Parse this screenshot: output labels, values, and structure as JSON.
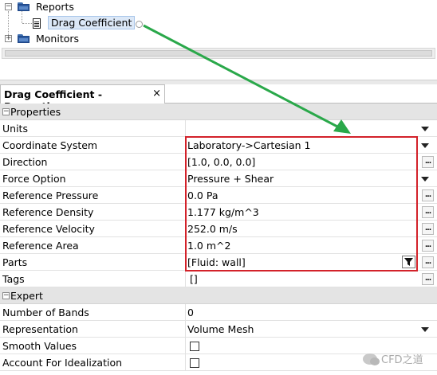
{
  "tree": {
    "reports_label": "Reports",
    "drag_label": "Drag Coefficient",
    "monitors_label": "Monitors"
  },
  "panel": {
    "title": "Drag Coefficient - Properties",
    "close_glyph": "×"
  },
  "sections": {
    "properties": "Properties",
    "expert": "Expert"
  },
  "properties": [
    {
      "name": "Units",
      "value": "",
      "control": "dropdown"
    },
    {
      "name": "Coordinate System",
      "value": "Laboratory->Cartesian 1",
      "control": "dropdown"
    },
    {
      "name": "Direction",
      "value": "[1.0, 0.0, 0.0]",
      "control": "ellipsis"
    },
    {
      "name": "Force Option",
      "value": "Pressure + Shear",
      "control": "dropdown"
    },
    {
      "name": "Reference Pressure",
      "value": "0.0 Pa",
      "control": "ellipsis"
    },
    {
      "name": "Reference Density",
      "value": "1.177 kg/m^3",
      "control": "ellipsis"
    },
    {
      "name": "Reference Velocity",
      "value": "252.0 m/s",
      "control": "ellipsis"
    },
    {
      "name": "Reference Area",
      "value": "1.0 m^2",
      "control": "ellipsis"
    },
    {
      "name": "Parts",
      "value": "[Fluid: wall]",
      "control": "filter+ellipsis"
    },
    {
      "name": "Tags",
      "value": "[]",
      "control": "ellipsis"
    }
  ],
  "expert": [
    {
      "name": "Number of Bands",
      "value": "0",
      "control": "none"
    },
    {
      "name": "Representation",
      "value": "Volume Mesh",
      "control": "dropdown"
    },
    {
      "name": "Smooth Values",
      "value": "",
      "control": "checkbox",
      "checked": false
    },
    {
      "name": "Account For Idealization",
      "value": "",
      "control": "checkbox",
      "checked": false
    }
  ],
  "buttons": {
    "ellipsis": "..."
  },
  "watermark": "CFD之道",
  "colors": {
    "highlight_box": "#d3222a",
    "arrow": "#2aa84a",
    "selection": "#dce8f7"
  }
}
